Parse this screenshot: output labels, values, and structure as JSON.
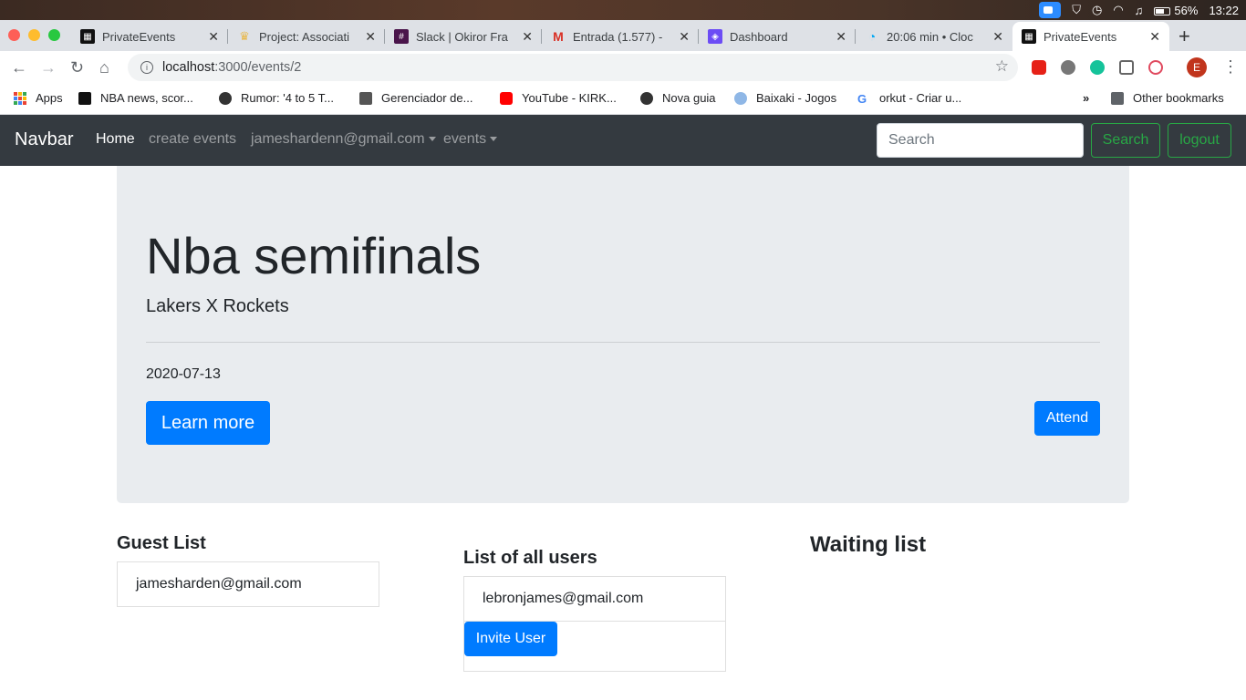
{
  "menubar": {
    "battery_text": "56%",
    "clock": "13:22"
  },
  "tabs": [
    {
      "title": "PrivateEvents",
      "icon": "privateevents-favicon",
      "color": "#111111"
    },
    {
      "title": "Project: Associati",
      "icon": "project-favicon",
      "color": "#e8b84a"
    },
    {
      "title": "Slack | Okiror Fra",
      "icon": "slack-favicon",
      "color": "#4a154b"
    },
    {
      "title": "Entrada (1.577) -",
      "icon": "gmail-favicon",
      "color": "#d93025"
    },
    {
      "title": "Dashboard",
      "icon": "dashboard-favicon",
      "color": "#6c4cf5"
    },
    {
      "title": "20:06 min • Cloc",
      "icon": "clockify-favicon",
      "color": "#03a9f4"
    },
    {
      "title": "PrivateEvents",
      "icon": "privateevents-favicon",
      "color": "#111111"
    }
  ],
  "address": {
    "host": "localhost",
    "path": ":3000/events/2"
  },
  "bookmarks": [
    {
      "label": "Apps"
    },
    {
      "label": "NBA news, scor..."
    },
    {
      "label": "Rumor: '4 to 5 T..."
    },
    {
      "label": "Gerenciador de..."
    },
    {
      "label": "YouTube - KIRK..."
    },
    {
      "label": "Nova guia"
    },
    {
      "label": "Baixaki - Jogos"
    },
    {
      "label": "orkut - Criar u..."
    },
    {
      "label": "Other bookmarks"
    }
  ],
  "profile_initial": "E",
  "navbar": {
    "brand": "Navbar",
    "home": "Home",
    "create": "create events",
    "user": "jameshardenn@gmail.com",
    "events": "events",
    "search_placeholder": "Search",
    "search_button": "Search",
    "logout_button": "logout"
  },
  "event": {
    "title": "Nba semifinals",
    "description": "Lakers X Rockets",
    "date": "2020-07-13",
    "learn_more": "Learn more",
    "attend": "Attend"
  },
  "guest_list": {
    "heading": "Guest List",
    "items": [
      "jamesharden@gmail.com"
    ]
  },
  "all_users": {
    "heading": "List of all users",
    "items": [
      "lebronjames@gmail.com"
    ],
    "invite_button": "Invite User"
  },
  "waiting_list": {
    "heading": "Waiting list"
  },
  "colors": {
    "navbar_bg": "#343a40",
    "primary": "#007bff",
    "success": "#28a745",
    "jumbotron_bg": "#e9ecef"
  }
}
